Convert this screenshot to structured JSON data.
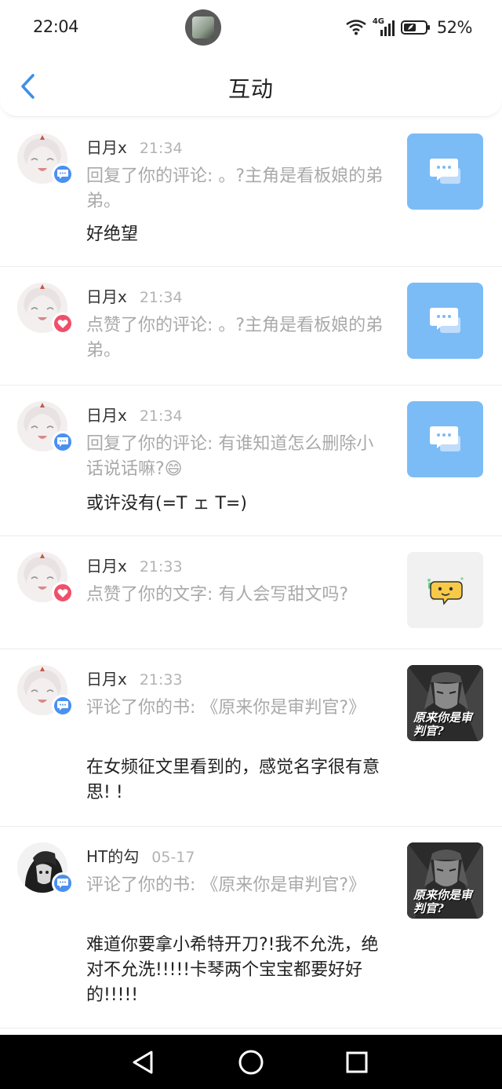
{
  "status": {
    "time": "22:04",
    "network": "4G",
    "battery": "52%"
  },
  "header": {
    "title": "互动"
  },
  "items": [
    {
      "name": "日月x",
      "time": "21:34",
      "action": "回复了你的评论: 。?主角是看板娘的弟弟。",
      "content": "好绝望",
      "badge": "comment",
      "thumb": "blue"
    },
    {
      "name": "日月x",
      "time": "21:34",
      "action": "点赞了你的评论: 。?主角是看板娘的弟弟。",
      "content": "",
      "badge": "like",
      "thumb": "blue"
    },
    {
      "name": "日月x",
      "time": "21:34",
      "action": "回复了你的评论: 有谁知道怎么删除小话说话嘛?😄",
      "content": "或许没有(=T ェ T=)",
      "badge": "comment",
      "thumb": "blue"
    },
    {
      "name": "日月x",
      "time": "21:33",
      "action": "点赞了你的文字: 有人会写甜文吗?",
      "content": "",
      "badge": "like",
      "thumb": "gray"
    },
    {
      "name": "日月x",
      "time": "21:33",
      "action": "评论了你的书: 《原来你是审判官?》",
      "content": "在女频征文里看到的，感觉名字很有意思! !",
      "badge": "comment",
      "thumb": "book",
      "thumb_text": "原来你是审判官?"
    },
    {
      "name": "HT的勾",
      "time": "05-17",
      "action": "评论了你的书: 《原来你是审判官?》",
      "content": "难道你要拿小希特开刀?!我不允洗，绝对不允洗!!!!!卡琴两个宝宝都要好好的!!!!!",
      "badge": "comment",
      "thumb": "book",
      "thumb_text": "原来你是审判官?"
    }
  ],
  "colors": {
    "accent": "#4a90f0",
    "like": "#ef4f6a",
    "thumb_blue": "#7bbcf6",
    "muted_text": "#a9a9a9"
  },
  "icons": {
    "back": "chevron-left-icon",
    "comment_badge": "comment-icon",
    "like_badge": "heart-icon",
    "thumb": "chat-bubbles-icon",
    "nav": [
      "back-triangle-icon",
      "home-circle-icon",
      "recents-square-icon"
    ]
  }
}
